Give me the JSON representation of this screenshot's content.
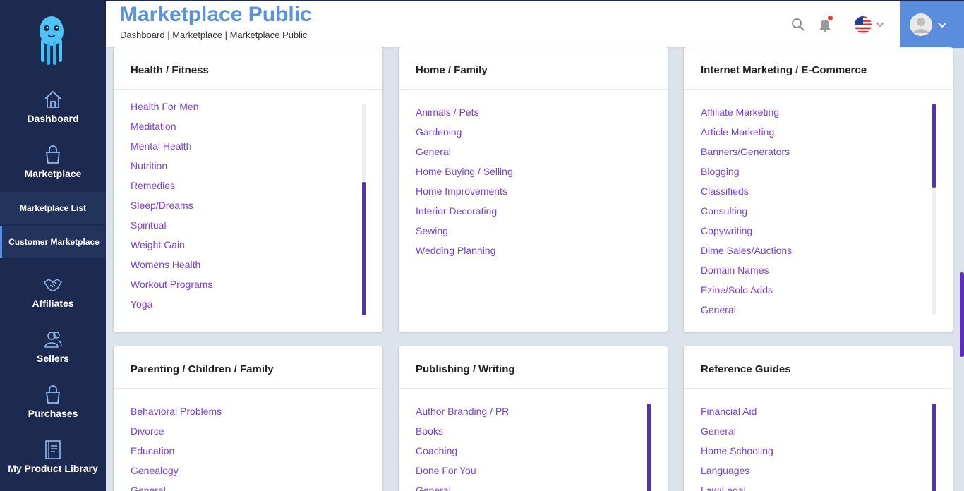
{
  "sidebar": {
    "nav": [
      {
        "label": "Dashboard",
        "icon": "home-icon"
      },
      {
        "label": "Marketplace",
        "icon": "shopping-bag-icon"
      },
      {
        "label": "Affiliates",
        "icon": "handshake-icon"
      },
      {
        "label": "Sellers",
        "icon": "users-icon"
      },
      {
        "label": "Purchases",
        "icon": "shopping-bag-icon"
      },
      {
        "label": "My Product Library",
        "icon": "book-icon"
      }
    ],
    "sub_items": [
      "Marketplace List",
      "Customer Marketplace"
    ],
    "active_sub": "Customer Marketplace"
  },
  "header": {
    "title": "Marketplace Public",
    "breadcrumb": "Dashboard | Marketplace | Marketplace Public",
    "icons": [
      "search-icon",
      "bell-icon",
      "us-flag-icon",
      "chevron-down-icon",
      "avatar"
    ]
  },
  "cards": [
    {
      "title": "Health / Fitness",
      "items": [
        "Health For Men",
        "Meditation",
        "Mental Health",
        "Nutrition",
        "Remedies",
        "Sleep/Dreams",
        "Spiritual",
        "Weight Gain",
        "Womens Health",
        "Workout Programs",
        "Yoga"
      ]
    },
    {
      "title": "Home / Family",
      "items": [
        "Animals / Pets",
        "Gardening",
        "General",
        "Home Buying / Selling",
        "Home Improvements",
        "Interior Decorating",
        "Sewing",
        "Wedding Planning"
      ]
    },
    {
      "title": "Internet Marketing / E-Commerce",
      "items": [
        "Affiliate Marketing",
        "Article Marketing",
        "Banners/Generators",
        "Blogging",
        "Classifieds",
        "Consulting",
        "Copywriting",
        "Dime Sales/Auctions",
        "Domain Names",
        "Ezine/Solo Adds",
        "General"
      ]
    },
    {
      "title": "Parenting / Children / Family",
      "items": [
        "Behavioral Problems",
        "Divorce",
        "Education",
        "Genealogy",
        "General"
      ]
    },
    {
      "title": "Publishing / Writing",
      "items": [
        "Author Branding / PR",
        "Books",
        "Coaching",
        "Done For You",
        "General"
      ]
    },
    {
      "title": "Reference Guides",
      "items": [
        "Financial Aid",
        "General",
        "Home Schooling",
        "Languages",
        "Law/Legal"
      ]
    }
  ],
  "colors": {
    "sidebar": "#1b2a4e",
    "accent": "#5b93d9",
    "link": "#7b3fd2",
    "scrollbar": "#5a2eb8"
  }
}
